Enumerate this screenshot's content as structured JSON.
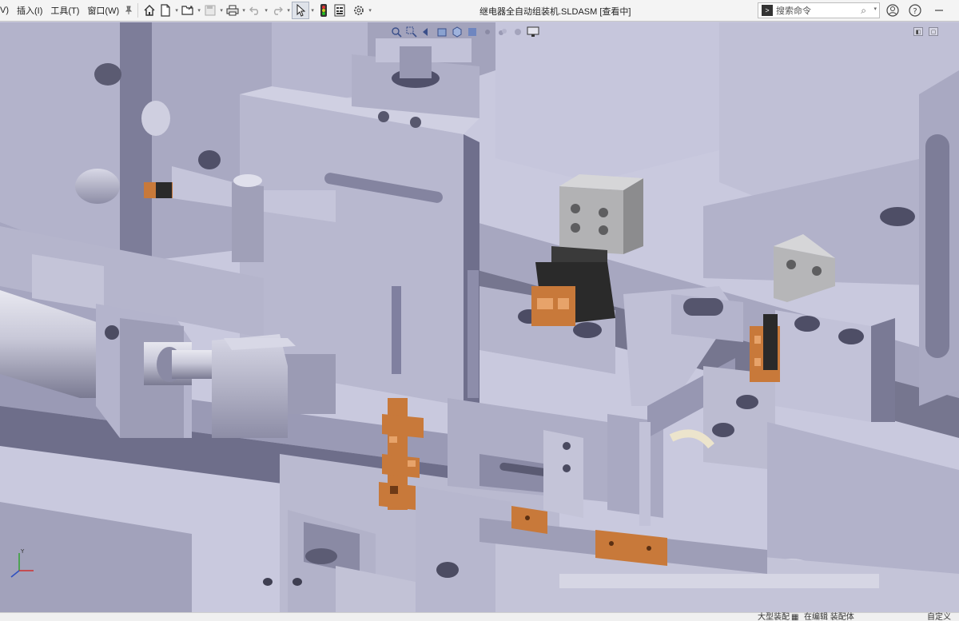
{
  "menu": {
    "items": [
      {
        "label": "V)"
      },
      {
        "label": "插入(I)"
      },
      {
        "label": "工具(T)"
      },
      {
        "label": "窗口(W)"
      }
    ]
  },
  "toolbar": {
    "icons": [
      "home-icon",
      "new-document-icon",
      "open-folder-icon",
      "save-icon",
      "print-icon",
      "undo-icon",
      "redo-icon",
      "select-pointer-icon",
      "traffic-light-icon",
      "file-properties-icon",
      "options-gear-icon"
    ]
  },
  "window": {
    "title": "继电器全自动组装机.SLDASM [查看中]"
  },
  "search": {
    "placeholder": "搜索命令"
  },
  "status": {
    "left_text": "大型装配",
    "mid_text": "在编辑 装配体",
    "right_text": "自定义"
  },
  "colors": {
    "viewport_bg": "#c9c9de",
    "part_face": "#b4b4cc",
    "part_side": "#8a8aa8",
    "part_dark": "#55556b",
    "copper": "#c8793a",
    "black_part": "#2a2a2a"
  }
}
